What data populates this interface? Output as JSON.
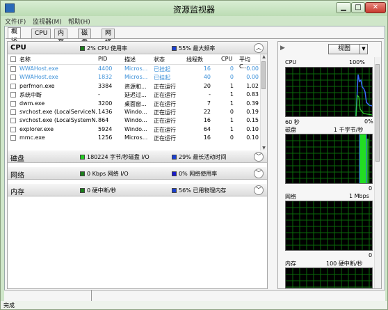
{
  "window": {
    "title": "资源监视器",
    "close_glyph": "✕",
    "min_glyph": "▁",
    "max_glyph": "□"
  },
  "menu": [
    "文件(F)",
    "监视器(M)",
    "帮助(H)"
  ],
  "tabs": [
    "概述",
    "CPU",
    "内存",
    "磁盘",
    "网络"
  ],
  "cpu": {
    "title": "CPU",
    "usage": "2% CPU 使用率",
    "freq": "55% 最大频率",
    "usage_color": "#1a7f1a",
    "freq_color": "#1a3fd0",
    "columns": [
      "名称",
      "PID",
      "描述",
      "状态",
      "线程数",
      "CPU",
      "平均 C..."
    ],
    "rows": [
      {
        "name": "WWAHost.exe",
        "pid": "4400",
        "desc": "Micros...",
        "status": "已挂起",
        "threads": "16",
        "cpu": "0",
        "avg": "0.00",
        "suspended": true
      },
      {
        "name": "WWAHost.exe",
        "pid": "1832",
        "desc": "Micros...",
        "status": "已挂起",
        "threads": "40",
        "cpu": "0",
        "avg": "0.00",
        "suspended": true
      },
      {
        "name": "perfmon.exe",
        "pid": "3384",
        "desc": "资源和...",
        "status": "正在运行",
        "threads": "20",
        "cpu": "1",
        "avg": "1.02",
        "suspended": false
      },
      {
        "name": "系统中断",
        "pid": "-",
        "desc": "延迟过...",
        "status": "正在运行",
        "threads": "-",
        "cpu": "1",
        "avg": "0.83",
        "suspended": false
      },
      {
        "name": "dwm.exe",
        "pid": "3200",
        "desc": "桌面窗...",
        "status": "正在运行",
        "threads": "7",
        "cpu": "1",
        "avg": "0.39",
        "suspended": false
      },
      {
        "name": "svchost.exe (LocalServiceN...",
        "pid": "1436",
        "desc": "Windo...",
        "status": "正在运行",
        "threads": "22",
        "cpu": "0",
        "avg": "0.19",
        "suspended": false
      },
      {
        "name": "svchost.exe (LocalSystemN...",
        "pid": "864",
        "desc": "Windo...",
        "status": "正在运行",
        "threads": "16",
        "cpu": "1",
        "avg": "0.15",
        "suspended": false
      },
      {
        "name": "explorer.exe",
        "pid": "5924",
        "desc": "Windo...",
        "status": "正在运行",
        "threads": "64",
        "cpu": "1",
        "avg": "0.10",
        "suspended": false
      },
      {
        "name": "mmc.exe",
        "pid": "1256",
        "desc": "Micros...",
        "status": "正在运行",
        "threads": "16",
        "cpu": "0",
        "avg": "0.10",
        "suspended": false
      }
    ]
  },
  "disk": {
    "title": "磁盘",
    "io": "180224 字节/秒磁盘 I/O",
    "active": "29% 最长活动时间",
    "io_color": "#22cc22",
    "active_color": "#1a3fd0"
  },
  "network": {
    "title": "网络",
    "io": "0 Kbps 网络 I/O",
    "usage": "0% 网络使用率",
    "io_color": "#1a7f1a",
    "usage_color": "#1a1acc"
  },
  "memory": {
    "title": "内存",
    "faults": "0 硬中断/秒",
    "used": "56% 已用物理内存",
    "faults_color": "#1a7f1a",
    "used_color": "#1a3fd0"
  },
  "right": {
    "view_label": "视图",
    "cpu_graph": {
      "label": "CPU",
      "max": "100%",
      "time": "60 秒",
      "min": "0%"
    },
    "disk_graph": {
      "label": "磁盘",
      "max": "1 千字节/秒",
      "min": "0"
    },
    "net_graph": {
      "label": "网络",
      "max": "1 Mbps",
      "min": "0"
    },
    "mem_graph": {
      "label": "内存",
      "max": "100 硬中断/秒"
    }
  },
  "status_text": "完成"
}
